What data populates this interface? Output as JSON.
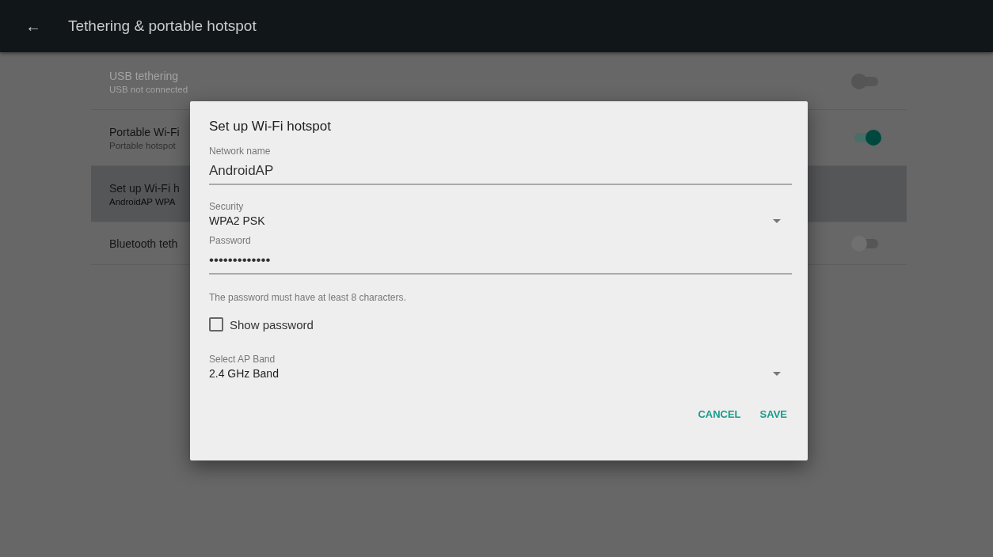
{
  "app_bar": {
    "back_icon": "←",
    "title": "Tethering & portable hotspot"
  },
  "settings": [
    {
      "kind": "switch",
      "title": "USB tethering",
      "subtitle": "USB not connected",
      "disabled": true,
      "selected": false,
      "on": false
    },
    {
      "kind": "switch",
      "title": "Portable Wi-Fi",
      "subtitle": "Portable hotspot",
      "disabled": false,
      "selected": false,
      "on": true
    },
    {
      "kind": "plain",
      "title": "Set up Wi-Fi h",
      "subtitle": "AndroidAP WPA",
      "disabled": false,
      "selected": true
    },
    {
      "kind": "switch",
      "title": "Bluetooth teth",
      "disabled": false,
      "selected": false,
      "on": false
    }
  ],
  "dialog": {
    "title": "Set up Wi-Fi hotspot",
    "fields": [
      {
        "kind": "text",
        "label": "Network name",
        "value": "AndroidAP"
      },
      {
        "kind": "dropdown",
        "label": "Security",
        "value": "WPA2 PSK"
      },
      {
        "kind": "text",
        "label": "Password",
        "value": "•••••••••••••"
      },
      {
        "kind": "hint",
        "value": "The password must have at least 8 characters."
      },
      {
        "kind": "checkbox",
        "value": "Show password",
        "checked": false
      },
      {
        "kind": "dropdown",
        "label": "Select AP Band",
        "value": "2.4 GHz Band"
      }
    ],
    "buttons": [
      "CANCEL",
      "SAVE"
    ]
  }
}
